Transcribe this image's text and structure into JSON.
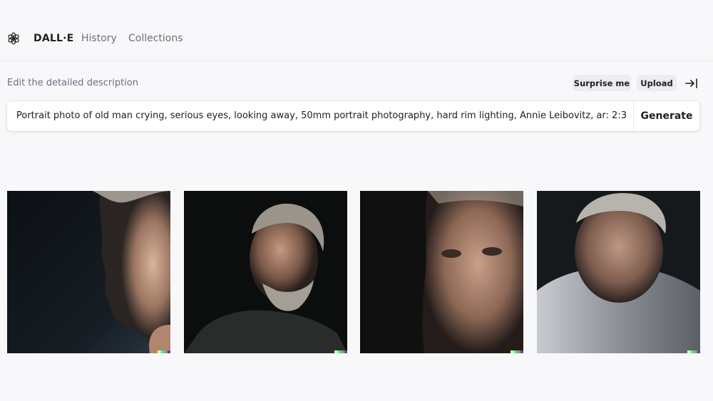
{
  "header": {
    "brand": "DALL·E",
    "nav": [
      {
        "label": "History"
      },
      {
        "label": "Collections"
      }
    ],
    "logo_icon": "openai-logo-icon"
  },
  "prompt": {
    "label": "Edit the detailed description",
    "value": "Portrait photo of old man crying, serious eyes, looking away, 50mm portrait photography, hard rim lighting, Annie Leibovitz, ar: 2:3",
    "generate_label": "Generate",
    "surprise_label": "Surprise me",
    "upload_label": "Upload",
    "collapse_icon": "collapse-right-icon"
  },
  "results": [
    {
      "subject": "elderly man profile, hand on chin, dark background"
    },
    {
      "subject": "bearded elderly man, grey hair, dark shirt"
    },
    {
      "subject": "elderly man close-up face, looking up"
    },
    {
      "subject": "elderly man front facing, grey polo shirt"
    }
  ],
  "colors": {
    "background": "#f8f8fa",
    "text_primary": "#202123",
    "text_secondary": "#6e6e80",
    "pill_bg": "#ececf1",
    "signature": [
      "#ffff66",
      "#42ffff",
      "#51da4c",
      "#ff6e3c",
      "#3c46ff"
    ]
  }
}
